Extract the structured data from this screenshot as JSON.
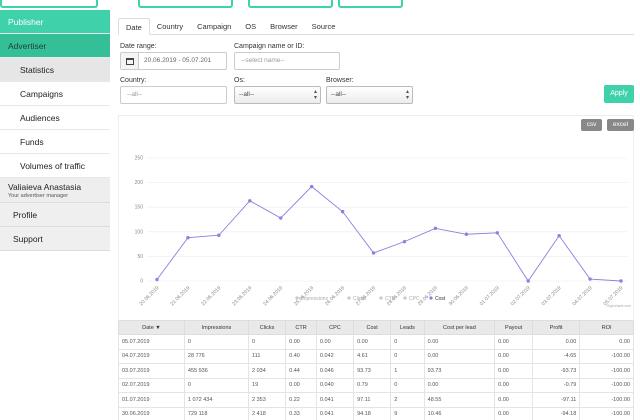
{
  "sidebar": {
    "publisher": "Publisher",
    "advertiser": "Advertiser",
    "items": [
      {
        "label": "Statistics"
      },
      {
        "label": "Campaigns"
      },
      {
        "label": "Audiences"
      },
      {
        "label": "Funds"
      },
      {
        "label": "Volumes of traffic"
      }
    ],
    "user_name": "Valiaieva Anastasia",
    "user_role": "Your advertiser manager",
    "profile": "Profile",
    "support": "Support"
  },
  "tabs": [
    "Date",
    "Country",
    "Campaign",
    "OS",
    "Browser",
    "Source"
  ],
  "filters": {
    "date_range_label": "Date range:",
    "date_range_value": "20.06.2019 - 05.07.201",
    "campaign_label": "Campaign name or ID:",
    "campaign_placeholder": "--select name--",
    "country_label": "Country:",
    "country_value": "--all--",
    "os_label": "Os:",
    "os_value": "--all--",
    "browser_label": "Browser:",
    "browser_value": "--all--",
    "apply": "Apply"
  },
  "export": {
    "csv": "csv",
    "excel": "excel"
  },
  "chart_data": {
    "type": "line",
    "categories": [
      "20.06.2019",
      "21.06.2019",
      "22.06.2019",
      "23.06.2019",
      "24.06.2019",
      "25.06.2019",
      "26.06.2019",
      "27.06.2019",
      "28.06.2019",
      "29.06.2019",
      "30.06.2019",
      "01.07.2019",
      "02.07.2019",
      "03.07.2019",
      "04.07.2019",
      "05.07.2019"
    ],
    "y_ticks": [
      "0",
      "50",
      "100",
      "150",
      "200",
      "250"
    ],
    "ylim": [
      0,
      250
    ],
    "series": [
      {
        "name": "Cost",
        "color": "#8a80dd",
        "values": [
          3,
          88,
          93,
          163,
          128,
          192,
          141,
          57,
          80,
          107,
          95,
          98,
          0,
          92,
          4,
          0
        ]
      }
    ],
    "legend": [
      "Impressions",
      "Clicks",
      "CTR",
      "CPC",
      "Cost"
    ],
    "grid": true,
    "credit": "Highcharts.com"
  },
  "table": {
    "columns": [
      "Date",
      "Impressions",
      "Clicks",
      "CTR",
      "CPC",
      "Cost",
      "Leads",
      "Cost per lead",
      "Payout",
      "Profit",
      "ROI"
    ],
    "rows": [
      [
        "05.07.2019",
        "0",
        "0",
        "0.00",
        "0.00",
        "0.00",
        "0",
        "0.00",
        "0.00",
        "0.00",
        "0.00"
      ],
      [
        "04.07.2019",
        "28 776",
        "111",
        "0.40",
        "0.042",
        "4.61",
        "0",
        "0.00",
        "0.00",
        "-4.65",
        "-100.00"
      ],
      [
        "03.07.2019",
        "455 936",
        "2 034",
        "0.44",
        "0.046",
        "93.73",
        "1",
        "93.73",
        "0.00",
        "-93.73",
        "-100.00"
      ],
      [
        "02.07.2019",
        "0",
        "19",
        "0.00",
        "0.040",
        "0.79",
        "0",
        "0.00",
        "0.00",
        "-0.79",
        "-100.00"
      ],
      [
        "01.07.2019",
        "1 072 434",
        "2 353",
        "0.22",
        "0.041",
        "97.11",
        "2",
        "48.55",
        "0.00",
        "-97.11",
        "-100.00"
      ],
      [
        "30.06.2019",
        "729 118",
        "2 418",
        "0.33",
        "0.041",
        "94.18",
        "9",
        "10.46",
        "0.00",
        "-94.18",
        "-100.00"
      ]
    ]
  },
  "colors": {
    "accent": "#3fd1aa",
    "series": "#8a80dd"
  }
}
